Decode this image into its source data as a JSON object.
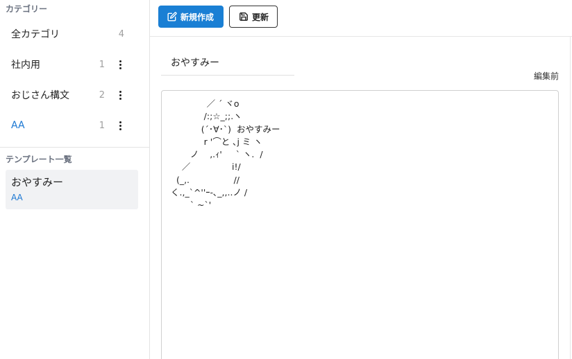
{
  "sidebar": {
    "categories_title": "カテゴリー",
    "categories": [
      {
        "label": "全カテゴリ",
        "count": "4",
        "has_menu": false
      },
      {
        "label": "社内用",
        "count": "1",
        "has_menu": true
      },
      {
        "label": "おじさん構文",
        "count": "2",
        "has_menu": true
      },
      {
        "label": "AA",
        "count": "1",
        "has_menu": true
      }
    ],
    "templates_title": "テンプレート一覧",
    "templates": [
      {
        "name": "おやすみー",
        "category": "AA"
      }
    ]
  },
  "toolbar": {
    "new_label": "新規作成",
    "update_label": "更新"
  },
  "editor": {
    "title_value": "おやすみー",
    "status": "編集前",
    "body": "             ／ ´ ヾo\n            /:;☆_;;.ヽ\n           (´･∀･`)  おやすみー\n            r '⌒と ､j ミ ヽ\n       ノ    ,.ｨ'     ` ヽ.  /\n    ／               i!/\n  (_,.                //\nく.,_`^''ｰ-､_,,..ノ /\n       ` ~`'"
  },
  "colors": {
    "accent": "#1a7fd4",
    "link": "#1976d2",
    "selected_bg": "#f1f2f4"
  }
}
